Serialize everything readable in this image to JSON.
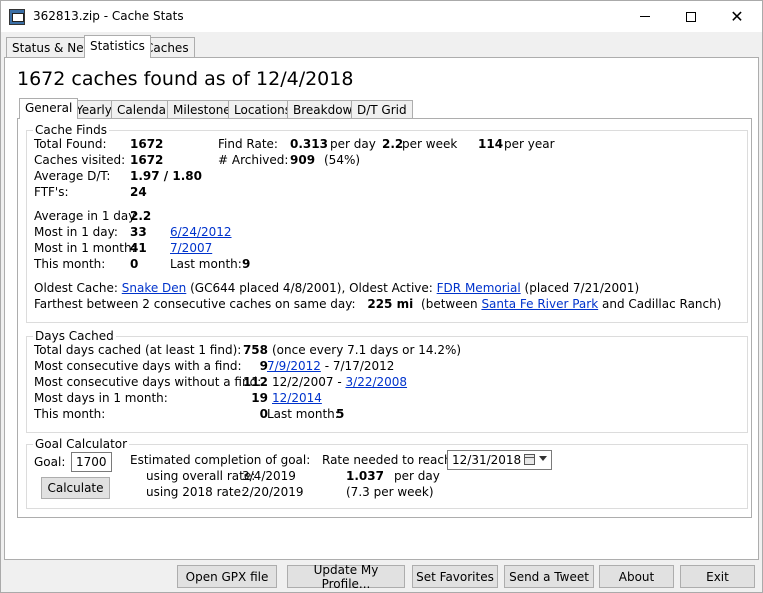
{
  "window": {
    "title": "362813.zip - Cache Stats"
  },
  "main_tabs": [
    "Status & News",
    "Statistics",
    "Caches"
  ],
  "headline": "1672 caches found as of 12/4/2018",
  "stat_tabs": [
    "General",
    "Yearly",
    "Calendar",
    "Milestones",
    "Locations",
    "Breakdown",
    "D/T Grid"
  ],
  "cache_finds": {
    "legend": "Cache Finds",
    "total_found_label": "Total Found:",
    "total_found": "1672",
    "visited_label": "Caches visited:",
    "visited": "1672",
    "avg_dt_label": "Average D/T:",
    "avg_dt": "1.97 / 1.80",
    "ftf_label": "FTF's:",
    "ftf": "24",
    "find_rate_label": "Find Rate:",
    "rate_day": "0.313",
    "per_day": "per day",
    "rate_week": "2.2",
    "per_week": "per week",
    "rate_year": "114",
    "per_year": "per year",
    "archived_label": "# Archived:",
    "archived": "909",
    "archived_pct": "(54%)",
    "avg_1day_label": "Average in 1 day:",
    "avg_1day": "2.2",
    "most_1day_label": "Most in 1 day:",
    "most_1day": "33",
    "most_1day_date": "6/24/2012",
    "most_1month_label": "Most in 1 month:",
    "most_1month": "41",
    "most_1month_date": "7/2007",
    "this_month_label": "This month:",
    "this_month": "0",
    "last_month_label": "Last month:",
    "last_month": "9",
    "oldest_label": "Oldest Cache:",
    "oldest_name": "Snake Den",
    "oldest_detail": "(GC644 placed 4/8/2001), Oldest Active:",
    "oldest_active_name": "FDR Memorial",
    "oldest_active_detail": "(placed 7/21/2001)",
    "farthest_label": "Farthest between 2 consecutive caches on same day:",
    "farthest_value": "225 mi",
    "farthest_between": "(between",
    "farthest_from": "Santa Fe River Park",
    "farthest_to": "and Cadillac Ranch)"
  },
  "days_cached": {
    "legend": "Days Cached",
    "total_label": "Total days cached (at least 1 find):",
    "total": "758",
    "total_detail": "(once every 7.1 days or 14.2%)",
    "consec_with_label": "Most consecutive days with a find:",
    "consec_with": "9",
    "consec_with_start": "7/9/2012",
    "consec_with_end": "- 7/17/2012",
    "consec_without_label": "Most consecutive days without a find:",
    "consec_without": "112",
    "consec_without_start": "12/2/2007 -",
    "consec_without_end": "3/22/2008",
    "most_month_label": "Most days in 1 month:",
    "most_month": "19",
    "most_month_date": "12/2014",
    "this_month_label": "This month:",
    "this_month": "0",
    "last_month_label": "Last month:",
    "last_month": "5"
  },
  "goal": {
    "legend": "Goal Calculator",
    "goal_label": "Goal:",
    "goal_value": "1700",
    "calculate": "Calculate",
    "est_label": "Estimated completion of goal:",
    "overall_label": "using overall rate:",
    "overall_date": "3/4/2019",
    "year_label": "using 2018 rate:",
    "year_date": "2/20/2019",
    "rate_needed_label": "Rate needed to reach by:",
    "target_date": "12/31/2018",
    "rate_needed": "1.037",
    "rate_needed_unit": "per day",
    "rate_needed_week": "(7.3 per week)"
  },
  "bottom_buttons": [
    "Open GPX file",
    "Update My Profile...",
    "Set Favorites",
    "Send a Tweet",
    "About",
    "Exit"
  ]
}
